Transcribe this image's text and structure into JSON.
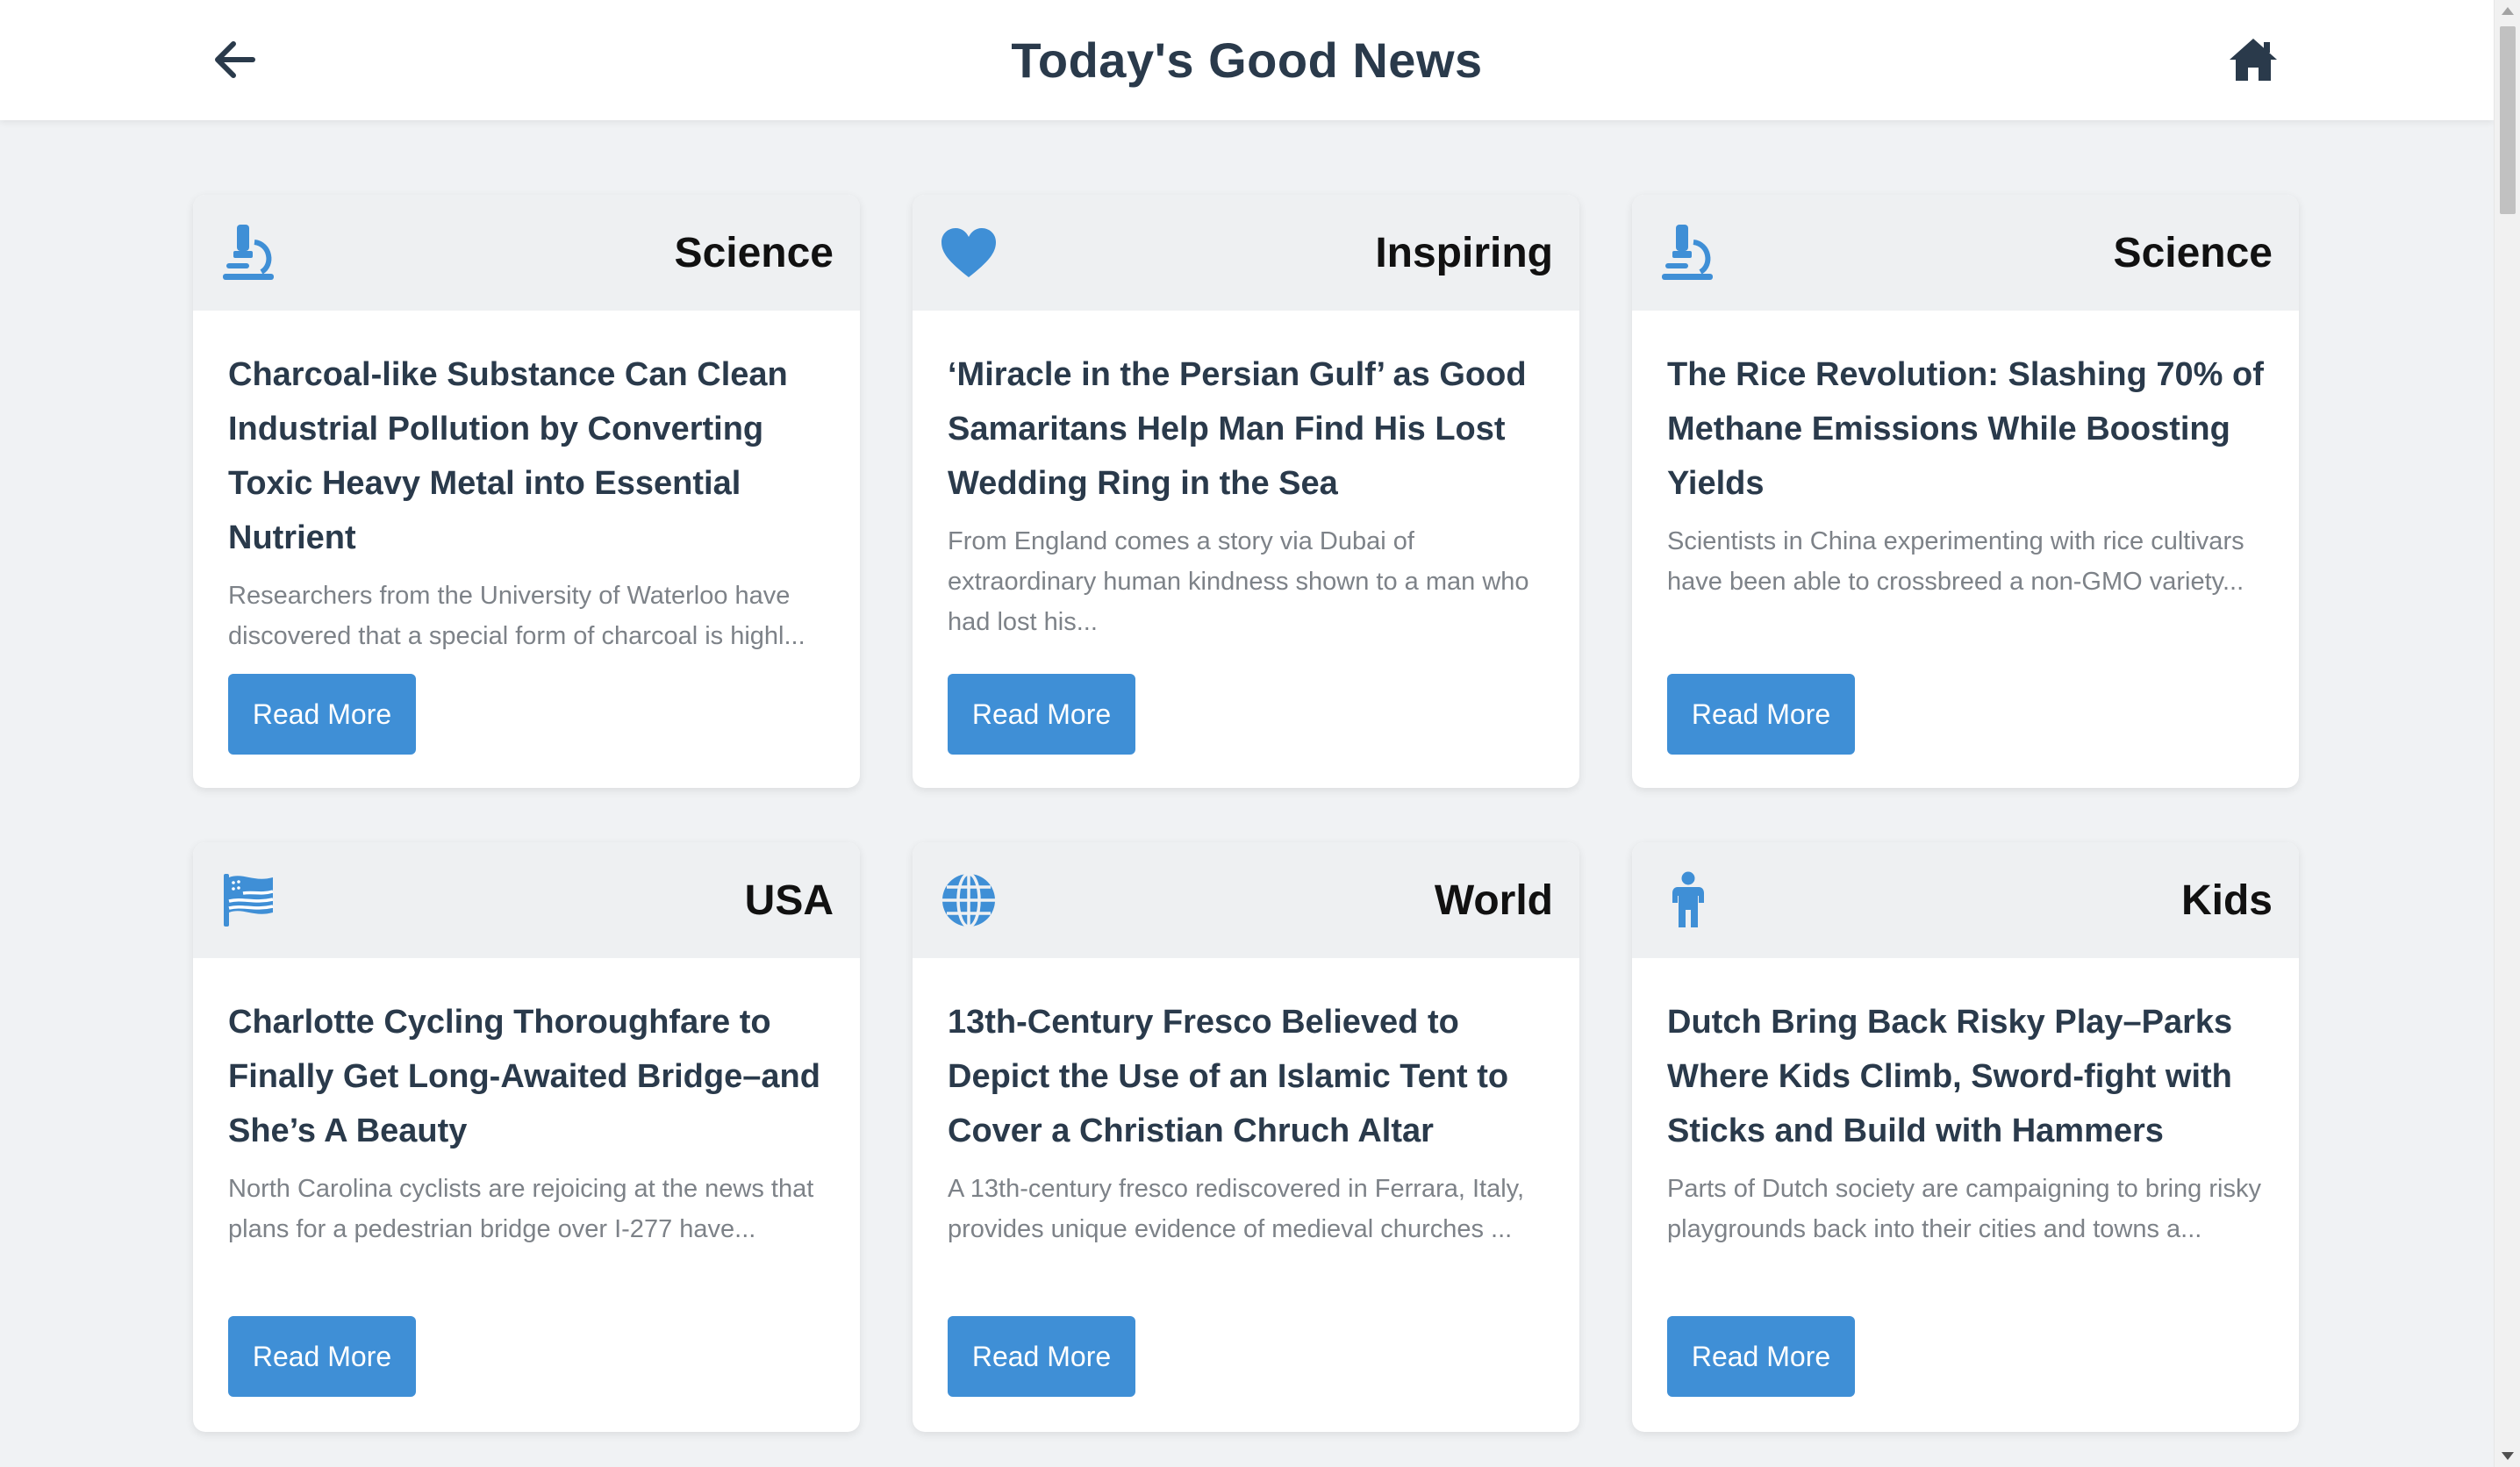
{
  "header": {
    "title": "Today's Good News",
    "back_icon": "arrow-left-icon",
    "home_icon": "home-icon"
  },
  "colors": {
    "accent": "#3f8fd6",
    "title_text": "#2a3a4b",
    "excerpt_text": "#7d8288",
    "card_header_bg": "#eef0f2",
    "page_bg": "#f0f2f4"
  },
  "cards": [
    {
      "category": "Science",
      "icon": "microscope-icon",
      "title": "Charcoal-like Substance Can Clean Industrial Pollution by Converting Toxic Heavy Metal into Essential Nutrient",
      "excerpt": "Researchers from the University of Waterloo have discovered that a special form of charcoal is highl...",
      "button": "Read More"
    },
    {
      "category": "Inspiring",
      "icon": "heart-icon",
      "title": "‘Miracle in the Persian Gulf’ as Good Samaritans Help Man Find His Lost Wedding Ring in the Sea",
      "excerpt": "From England comes a story via Dubai of extraordinary human kindness shown to a man who had lost his...",
      "button": "Read More"
    },
    {
      "category": "Science",
      "icon": "microscope-icon",
      "title": "The Rice Revolution: Slashing 70% of Methane Emissions While Boosting Yields",
      "excerpt": "Scientists in China experimenting with rice cultivars have been able to crossbreed a non-GMO variety...",
      "button": "Read More"
    },
    {
      "category": "USA",
      "icon": "flag-usa-icon",
      "title": "Charlotte Cycling Thoroughfare to Finally Get Long-Awaited Bridge–and She’s A Beauty",
      "excerpt": "North Carolina cyclists are rejoicing at the news that plans for a pedestrian bridge over I-277 have...",
      "button": "Read More"
    },
    {
      "category": "World",
      "icon": "globe-icon",
      "title": "13th-Century Fresco Believed to Depict the Use of an Islamic Tent to Cover a Christian Chruch Altar",
      "excerpt": "A 13th-century fresco rediscovered in Ferrara, Italy, provides unique evidence of medieval churches ...",
      "button": "Read More"
    },
    {
      "category": "Kids",
      "icon": "child-icon",
      "title": "Dutch Bring Back Risky Play–Parks Where Kids Climb, Sword-fight with Sticks and Build with Hammers",
      "excerpt": "Parts of Dutch society are campaigning to bring risky playgrounds back into their cities and towns a...",
      "button": "Read More"
    }
  ]
}
